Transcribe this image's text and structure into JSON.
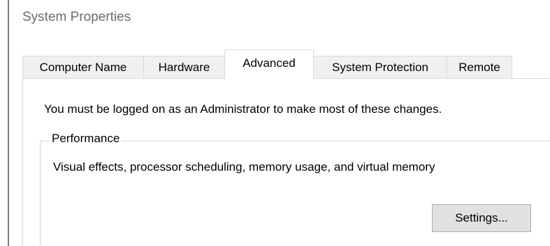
{
  "window": {
    "title": "System Properties"
  },
  "tabs": [
    {
      "label": "Computer Name",
      "active": false
    },
    {
      "label": "Hardware",
      "active": false
    },
    {
      "label": "Advanced",
      "active": true
    },
    {
      "label": "System Protection",
      "active": false
    },
    {
      "label": "Remote",
      "active": false
    }
  ],
  "advanced": {
    "admin_notice": "You must be logged on as an Administrator to make most of these changes.",
    "performance": {
      "group_label": "Performance",
      "description": "Visual effects, processor scheduling, memory usage, and virtual memory",
      "settings_button": "Settings..."
    }
  },
  "colors": {
    "title_text": "#6d6d6d",
    "inactive_tab_bg": "#f0f0f0",
    "button_bg": "#e1e1e1",
    "button_border": "#adadad"
  }
}
